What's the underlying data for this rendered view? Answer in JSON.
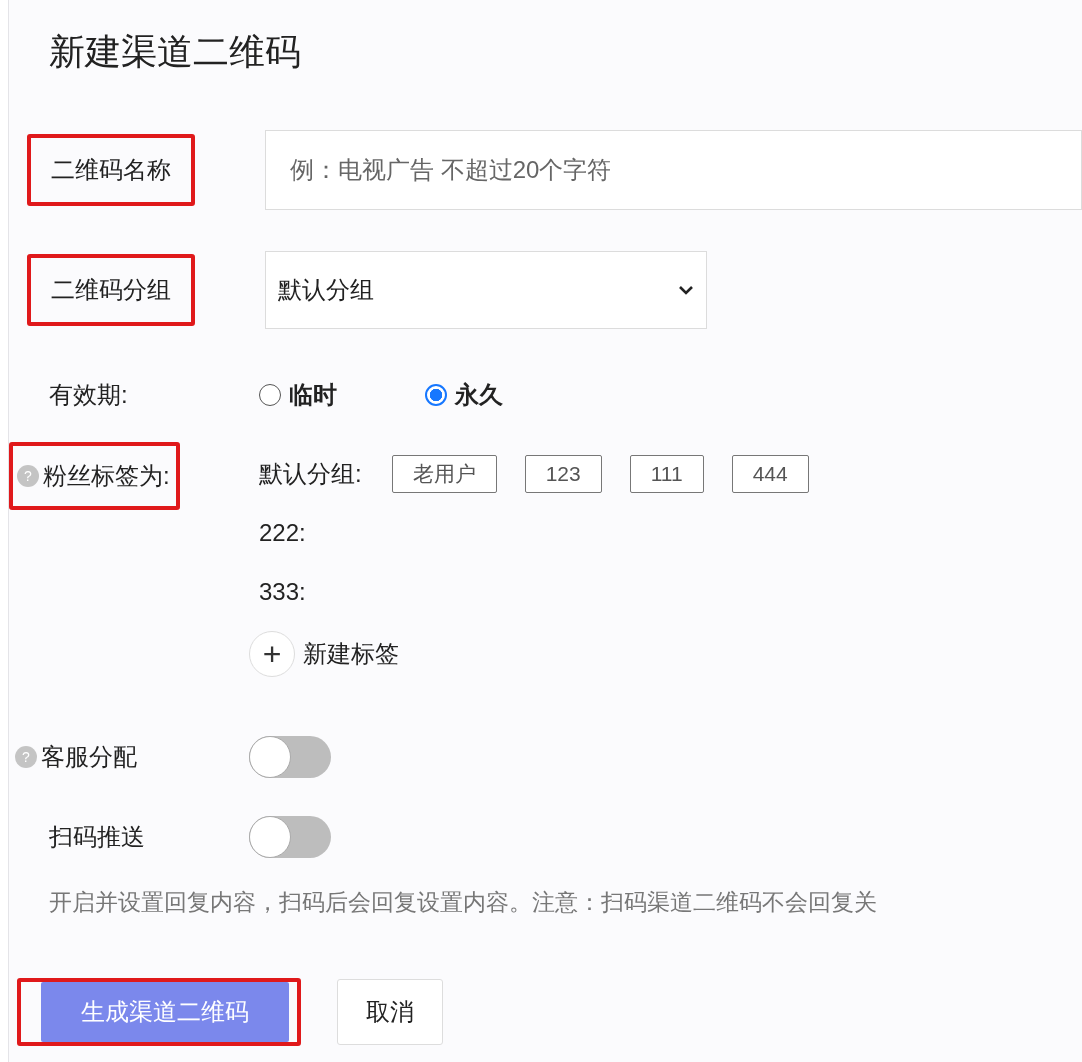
{
  "title": "新建渠道二维码",
  "name_field": {
    "label": "二维码名称",
    "highlighted": true,
    "placeholder": "例：电视广告 不超过20个字符"
  },
  "group_field": {
    "label": "二维码分组",
    "highlighted": true,
    "value": "默认分组"
  },
  "validity": {
    "label": "有效期:",
    "options": [
      {
        "label": "临时",
        "selected": false
      },
      {
        "label": "永久",
        "selected": true
      }
    ]
  },
  "fan_tags": {
    "help": "?",
    "label": "粉丝标签为:",
    "highlighted": true,
    "groups": [
      {
        "name": "默认分组:",
        "tags": [
          "老用户",
          "123",
          "111",
          "444"
        ]
      },
      {
        "name": "222:"
      },
      {
        "name": "333:"
      }
    ],
    "new_tag": {
      "icon": "+",
      "label": "新建标签"
    }
  },
  "toggles": [
    {
      "help": "?",
      "label": "客服分配",
      "on": false
    },
    {
      "label": "扫码推送",
      "on": false
    }
  ],
  "hint": "开启并设置回复内容，扫码后会回复设置内容。注意：扫码渠道二维码不会回复关",
  "buttons": {
    "primary": {
      "label": "生成渠道二维码",
      "highlighted": true
    },
    "cancel": {
      "label": "取消"
    }
  }
}
